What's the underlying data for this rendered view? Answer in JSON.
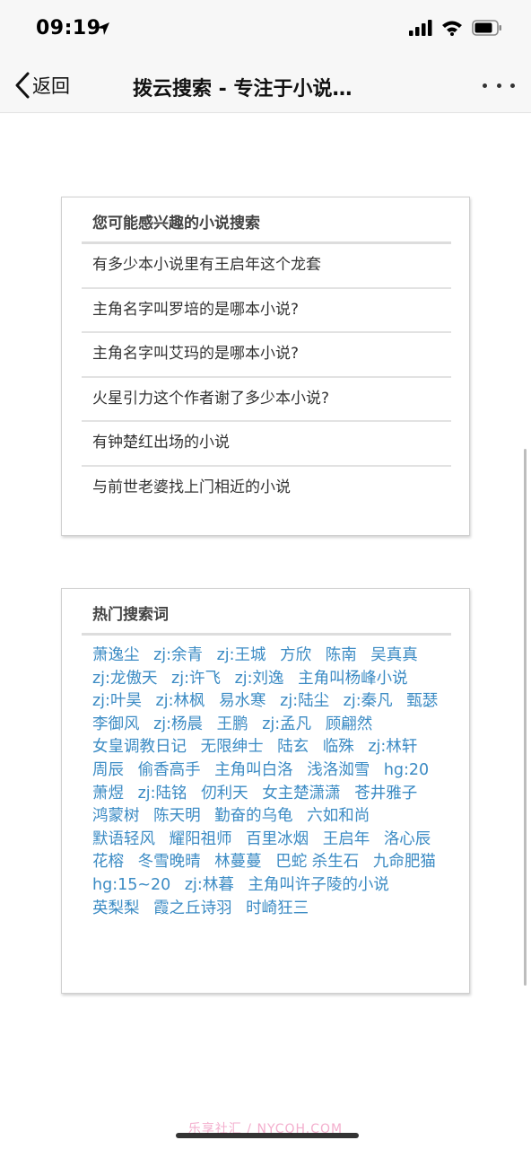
{
  "status_bar": {
    "time": "09:19"
  },
  "nav": {
    "back_label": "返回",
    "title": "拨云搜索 - 专注于小说…"
  },
  "suggest_card": {
    "title": "您可能感兴趣的小说搜索",
    "items": [
      "有多少本小说里有王启年这个龙套",
      "主角名字叫罗培的是哪本小说?",
      "主角名字叫艾玛的是哪本小说?",
      "火星引力这个作者谢了多少本小说?",
      "有钟楚红出场的小说",
      "与前世老婆找上门相近的小说"
    ]
  },
  "hot_card": {
    "title": "热门搜索词",
    "words": [
      "萧逸尘",
      "zj:余青",
      "zj:王城",
      "方欣",
      "陈南",
      "吴真真",
      "zj:龙傲天",
      "zj:许飞",
      "zj:刘逸",
      "主角叫杨峰小说",
      "zj:叶昊",
      "zj:林枫",
      "易水寒",
      "zj:陆尘",
      "zj:秦凡",
      "甄瑟",
      "李御风",
      "zj:杨晨",
      "王鹏",
      "zj:孟凡",
      "顾翩然",
      "女皇调教日记",
      "无限绅士",
      "陆玄",
      "临殊",
      "zj:林轩",
      "周辰",
      "偷香高手",
      "主角叫白洛",
      "浅洛洳雪",
      "hg:20",
      "萧煜",
      "zj:陆铭",
      "仞利天",
      "女主楚潇潇",
      "苍井雅子",
      "鸿蒙树",
      "陈天明",
      "勤奋的乌龟",
      "六如和尚",
      "默语轻风",
      "耀阳祖师",
      "百里冰烟",
      "王启年",
      "洛心辰",
      "花榕",
      "冬雪晚晴",
      "林蔓蔓",
      "巴蛇 杀生石",
      "九命肥猫",
      "hg:15~20",
      "zj:林暮",
      "主角叫许子陵的小说",
      "英梨梨",
      "霞之丘诗羽",
      "时崎狂三"
    ]
  },
  "watermark": "乐享社汇 / NYCQH.COM",
  "colors": {
    "link": "#3b8bc4",
    "text": "#333333",
    "bar_bg": "#f7f7f7",
    "card_border": "#cfcfcf"
  }
}
